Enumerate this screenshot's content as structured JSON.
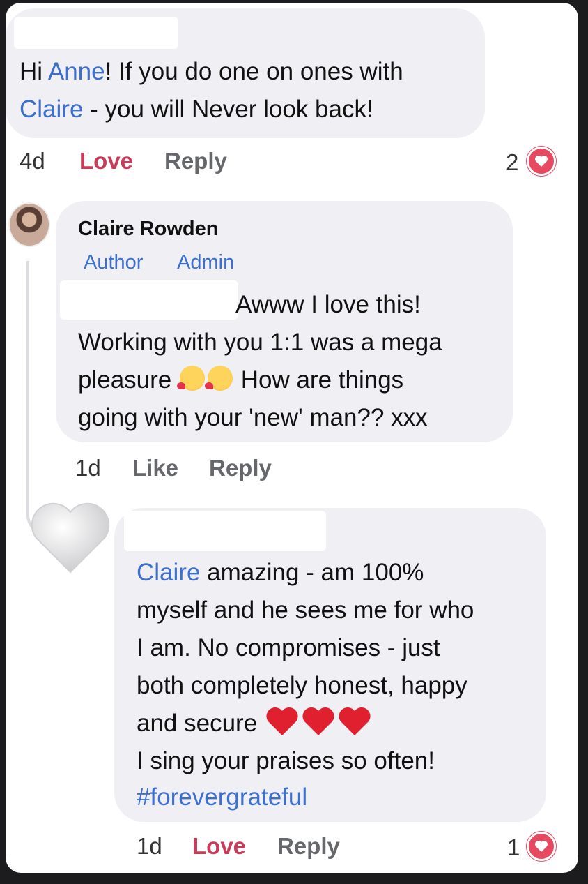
{
  "comment1": {
    "greeting": "Hi ",
    "mention1": "Anne",
    "line1_rest": "! If you do one on ones with",
    "mention2": "Claire",
    "line2_rest": " - you will Never look back!",
    "time": "4d",
    "love_label": "Love",
    "reply_label": "Reply",
    "reaction_count": "2"
  },
  "reply1": {
    "author": "Claire Rowden",
    "badge_author": "Author",
    "badge_admin": "Admin",
    "line1": "Awww I love this!",
    "line2": "Working with you 1:1 was a mega",
    "line3_a": "pleasure ",
    "line3_b": " How are things",
    "line4": "going with your 'new' man?? xxx",
    "emoji_name": "smiling-face-with-hearts-emoji",
    "time": "1d",
    "like_label": "Like",
    "reply_label": "Reply"
  },
  "reply2": {
    "mention": "Claire",
    "line1_rest": " amazing - am 100%",
    "line2": "myself and he sees me for who",
    "line3": "I am. No compromises - just",
    "line4": "both completely honest, happy",
    "line5": "and secure ",
    "line6": "I sing your praises so often!",
    "hashtag": "#forevergrateful",
    "emoji_name": "red-heart-emoji",
    "avatar_icon": "white-heart-icon",
    "time": "1d",
    "love_label": "Love",
    "reply_label": "Reply",
    "reaction_count": "1"
  },
  "colors": {
    "mention": "#3b6fd0",
    "love": "#c83c5a",
    "bubble": "#efeff4",
    "reaction": "#e64960"
  }
}
